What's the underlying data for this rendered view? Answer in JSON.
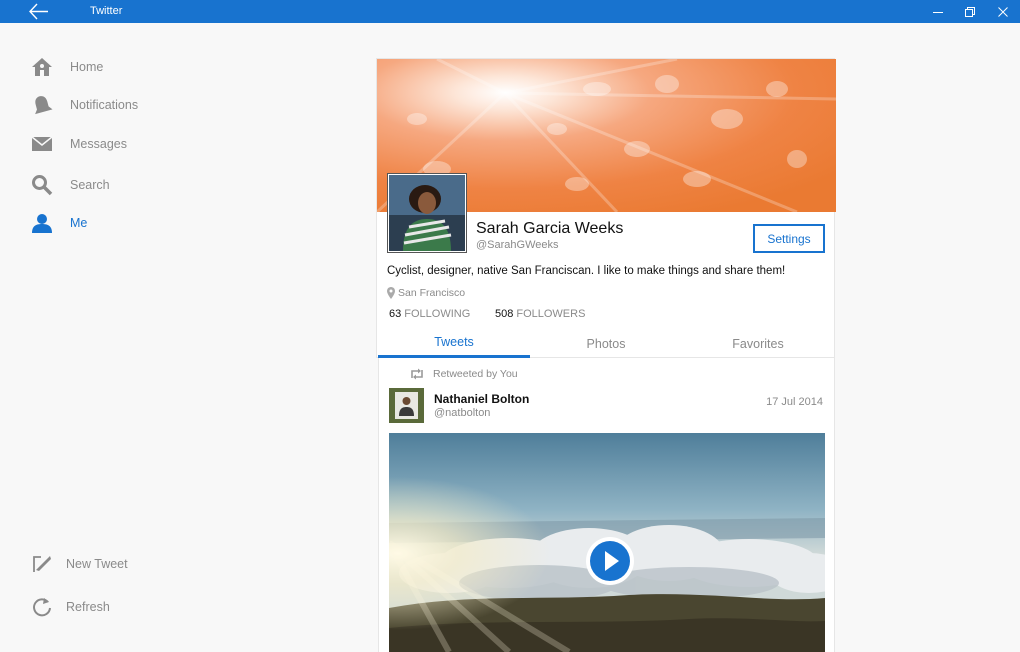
{
  "window": {
    "title": "Twitter"
  },
  "sidebar": {
    "items": [
      {
        "label": "Home",
        "icon": "home-icon"
      },
      {
        "label": "Notifications",
        "icon": "bell-icon"
      },
      {
        "label": "Messages",
        "icon": "envelope-icon"
      },
      {
        "label": "Search",
        "icon": "search-icon"
      },
      {
        "label": "Me",
        "icon": "person-icon",
        "active": true
      }
    ],
    "bottom": [
      {
        "label": "New Tweet",
        "icon": "compose-icon"
      },
      {
        "label": "Refresh",
        "icon": "refresh-icon"
      }
    ]
  },
  "profile": {
    "name": "Sarah Garcia Weeks",
    "handle": "@SarahGWeeks",
    "settings_label": "Settings",
    "bio": "Cyclist, designer, native San Franciscan. I like to make things and share them!",
    "location": "San Francisco",
    "following_count": "63",
    "following_label": "FOLLOWING",
    "followers_count": "508",
    "followers_label": "FOLLOWERS",
    "tabs": [
      "Tweets",
      "Photos",
      "Favorites"
    ],
    "active_tab": "Tweets"
  },
  "tweet": {
    "retweet_label": "Retweeted by You",
    "author_name": "Nathaniel Bolton",
    "author_handle": "@natbolton",
    "date": "17 Jul 2014",
    "media_type": "video"
  },
  "colors": {
    "accent": "#1873cf",
    "muted_text": "#8a8a8a",
    "background": "#f8f8f8"
  }
}
